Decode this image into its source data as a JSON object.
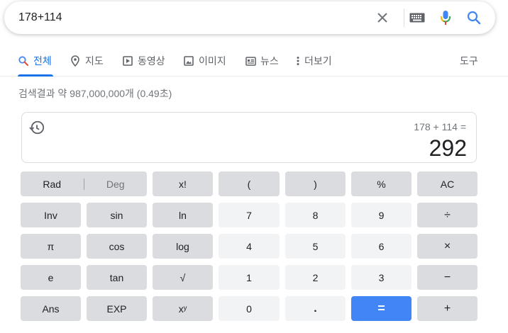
{
  "search": {
    "query": "178+114",
    "icons": [
      "close-icon",
      "keyboard-icon",
      "mic-icon",
      "search-icon"
    ]
  },
  "tabs": [
    {
      "label": "전체",
      "icon": "search-icon",
      "active": true
    },
    {
      "label": "지도",
      "icon": "map-pin-icon"
    },
    {
      "label": "동영상",
      "icon": "video-icon"
    },
    {
      "label": "이미지",
      "icon": "image-icon"
    },
    {
      "label": "뉴스",
      "icon": "news-icon"
    },
    {
      "label": "더보기",
      "icon": "more-vert-icon"
    },
    {
      "label": "도구"
    }
  ],
  "result_stats": "검색결과 약 987,000,000개 (0.49초)",
  "calculator": {
    "expression": "178 + 114 =",
    "result": "292",
    "keys": {
      "rad": "Rad",
      "deg": "Deg",
      "fact": "x!",
      "lparen": "(",
      "rparen": ")",
      "percent": "%",
      "ac": "AC",
      "inv": "Inv",
      "sin": "sin",
      "ln": "ln",
      "k7": "7",
      "k8": "8",
      "k9": "9",
      "div": "÷",
      "pi": "π",
      "cos": "cos",
      "log": "log",
      "k4": "4",
      "k5": "5",
      "k6": "6",
      "mul": "×",
      "e": "e",
      "tan": "tan",
      "sqrt": "√",
      "k1": "1",
      "k2": "2",
      "k3": "3",
      "sub": "−",
      "ans": "Ans",
      "exp": "EXP",
      "pow": "xʸ",
      "k0": "0",
      "dot": ".",
      "eq": "=",
      "add": "+"
    }
  },
  "colors": {
    "accent": "#1a73e8",
    "equals_key": "#4285f4",
    "fn_key": "#dadce0",
    "num_key": "#f1f3f4"
  }
}
